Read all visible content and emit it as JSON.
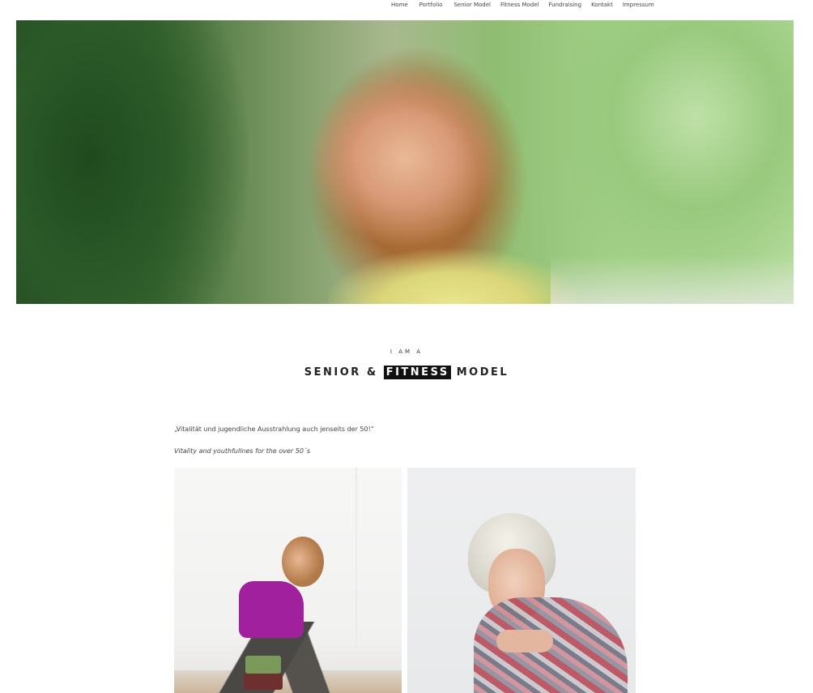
{
  "nav": {
    "items": [
      "Home",
      "Portfolio",
      "Senior Model",
      "Fitness Model",
      "Fundraising",
      "Kontakt",
      "Impressum"
    ]
  },
  "hero": {
    "image_alt": "Portrait of a woman with shoulder-length strawberry-blonde hair in front of blurred green trees"
  },
  "intro": {
    "kicker": "I AM A",
    "headline_before": "SENIOR &",
    "headline_highlight": "FITNESS",
    "headline_after": "MODEL"
  },
  "quotes": {
    "german": "„Vitalität und jugendliche Ausstrahlung auch jenseits der 50!“",
    "english": "Vitality and youthfullnes for the over 50´s"
  },
  "gallery": {
    "left_alt": "Woman in purple top doing a yoga stretch on blocks",
    "right_alt": "Woman with short silver hair resting chin on hand, wearing a colorful knitted shawl"
  },
  "colors": {
    "highlight_bg": "#111111",
    "highlight_text": "#ffffff",
    "text": "#222222"
  }
}
